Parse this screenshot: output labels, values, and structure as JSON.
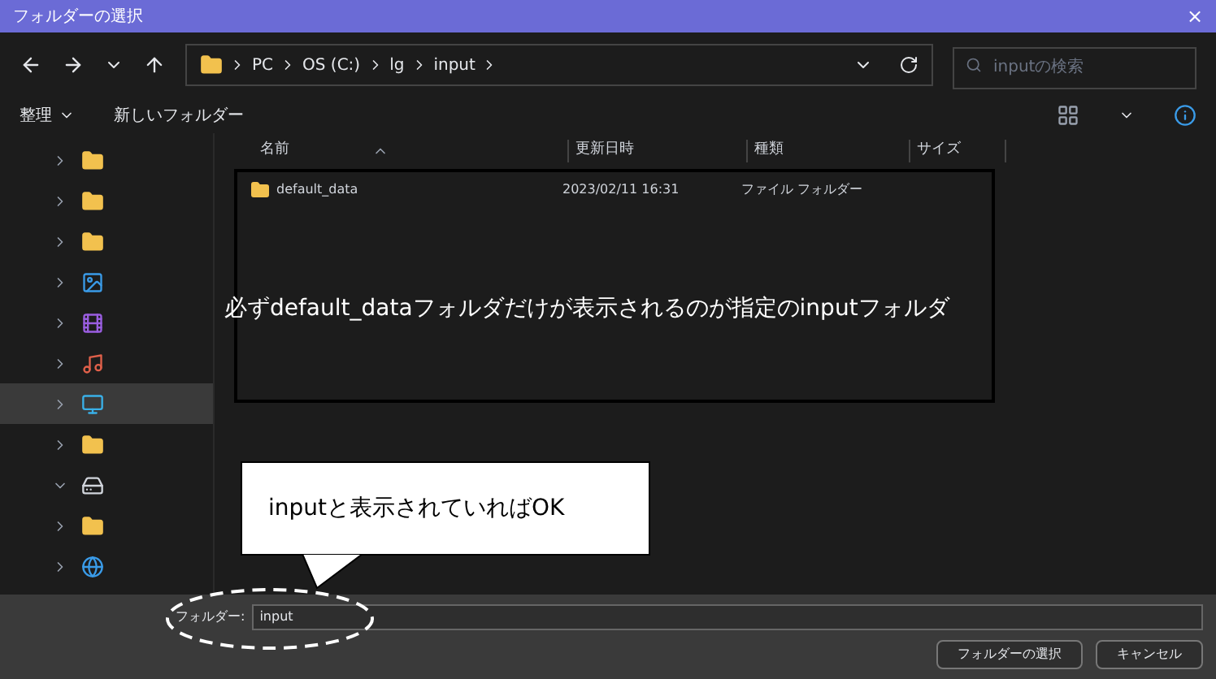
{
  "window": {
    "title": "フォルダーの選択",
    "close": "×"
  },
  "address": {
    "path": [
      "PC",
      "OS (C:)",
      "lg",
      "input"
    ]
  },
  "search": {
    "placeholder": "inputの検索"
  },
  "toolbar": {
    "organize": "整理",
    "new_folder": "新しいフォルダー"
  },
  "sidebar": {
    "items": [
      {
        "kind": "folder",
        "expanded": false,
        "selected": false
      },
      {
        "kind": "folder",
        "expanded": false,
        "selected": false
      },
      {
        "kind": "folder",
        "expanded": false,
        "selected": false
      },
      {
        "kind": "pictures",
        "expanded": false,
        "selected": false
      },
      {
        "kind": "videos",
        "expanded": false,
        "selected": false
      },
      {
        "kind": "music",
        "expanded": false,
        "selected": false
      },
      {
        "kind": "desktop",
        "expanded": false,
        "selected": true
      },
      {
        "kind": "folder",
        "expanded": false,
        "selected": false
      },
      {
        "kind": "drive",
        "expanded": true,
        "selected": false
      },
      {
        "kind": "folder",
        "expanded": false,
        "selected": false
      },
      {
        "kind": "network",
        "expanded": false,
        "selected": false
      }
    ]
  },
  "table": {
    "columns": [
      "名前",
      "更新日時",
      "種類",
      "サイズ"
    ],
    "rows": [
      {
        "name": "default_data",
        "modified": "2023/02/11 16:31",
        "type": "ファイル フォルダー"
      }
    ]
  },
  "annotations": {
    "note": "必ずdefault_dataフォルダだけが表示されるのが指定のinputフォルダ",
    "callout": "inputと表示されていればOK"
  },
  "footer": {
    "folder_label": "フォルダー:",
    "folder_value": "input",
    "buttons": [
      "フォルダーの選択",
      "キャンセル"
    ]
  }
}
